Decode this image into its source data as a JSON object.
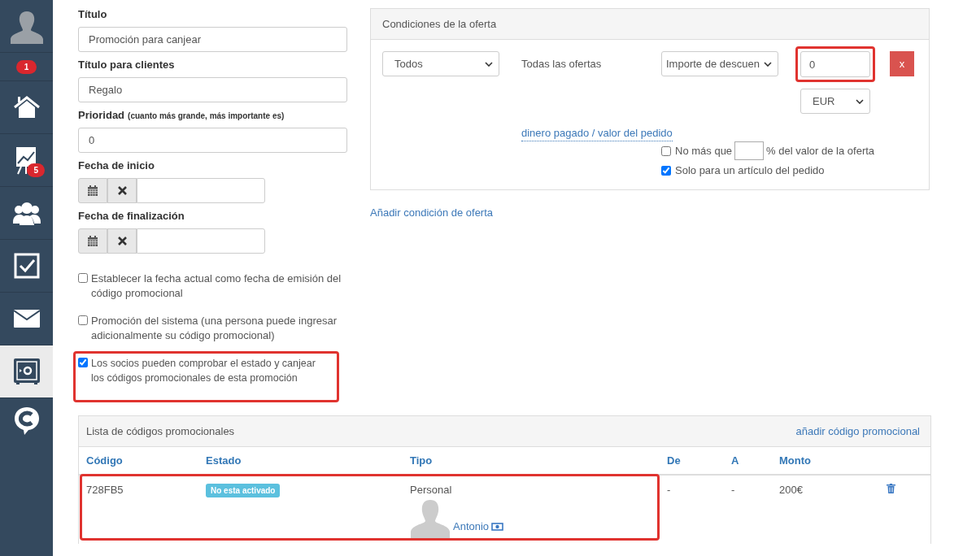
{
  "sidebar": {
    "items": [
      {
        "kind": "avatar",
        "selected": false
      },
      {
        "kind": "badge",
        "badge": "1",
        "selected": false
      },
      {
        "kind": "home",
        "selected": false
      },
      {
        "kind": "chart",
        "badge": "5",
        "selected": false
      },
      {
        "kind": "people",
        "selected": false
      },
      {
        "kind": "tasks",
        "selected": false
      },
      {
        "kind": "mail",
        "selected": false
      },
      {
        "kind": "safe",
        "selected": true
      },
      {
        "kind": "logo",
        "selected": false
      }
    ]
  },
  "form": {
    "fields": [
      {
        "kind": "text",
        "label": "Título",
        "value": "Promoción para canjear"
      },
      {
        "kind": "text",
        "label": "Título para clientes",
        "value": "Regalo"
      },
      {
        "kind": "text",
        "label": "Prioridad",
        "hint": "(cuanto más grande, más importante es)",
        "value": "0"
      },
      {
        "kind": "date",
        "label": "Fecha de inicio"
      },
      {
        "kind": "date",
        "label": "Fecha de finalización"
      }
    ],
    "options": [
      {
        "label": "Establecer la fecha actual como fecha de emisión del código promocional",
        "checked": false,
        "highlighted": false
      },
      {
        "label": "Promoción del sistema (una persona puede ingresar adicionalmente su código promocional)",
        "checked": false,
        "highlighted": false
      },
      {
        "label": "Los socios pueden comprobar el estado y canjear los códigos promocionales de esta promoción",
        "checked": true,
        "highlighted": true
      }
    ]
  },
  "conditions": {
    "title": "Condiciones de la oferta",
    "scope": "Todos",
    "description": "Todas las ofertas",
    "discount_type": "Importe de descuen",
    "amount": "0",
    "amount_highlighted": true,
    "remove": "x",
    "currency": "EUR",
    "basis_link": "dinero pagado / valor del pedido",
    "limit": {
      "prefix": "No más que",
      "suffix": "% del valor de la oferta",
      "checked": false
    },
    "single_item": {
      "label": "Solo para un artículo del pedido",
      "checked": true
    }
  },
  "add_condition": "Añadir condición de oferta",
  "codes": {
    "title": "Lista de códigos promocionales",
    "add_link": "añadir código promocional",
    "columns": [
      "Código",
      "Estado",
      "Tipo",
      "De",
      "A",
      "Monto"
    ],
    "rows": [
      {
        "code": "728FB5",
        "status": "No esta activado",
        "type": "Personal",
        "person": "Antonio",
        "from": "-",
        "to": "-",
        "amount": "200€",
        "highlighted": true
      }
    ]
  }
}
